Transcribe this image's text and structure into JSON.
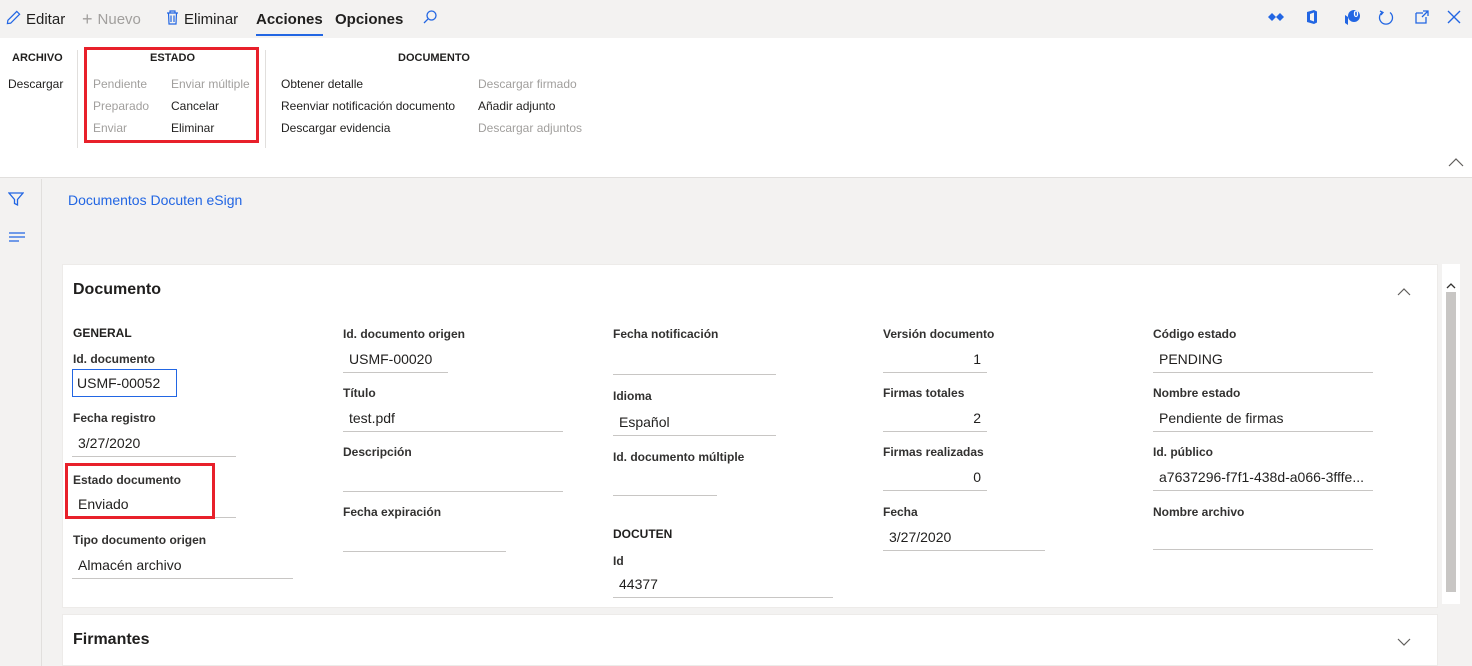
{
  "toolbar": {
    "edit_label": "Editar",
    "new_label": "Nuevo",
    "delete_label": "Eliminar",
    "tab_actions": "Acciones",
    "tab_options": "Opciones",
    "notification_count": "0"
  },
  "ribbon": {
    "archivo": {
      "header": "ARCHIVO",
      "items": [
        "Descargar"
      ]
    },
    "estado": {
      "header": "ESTADO",
      "col1": [
        "Pendiente",
        "Preparado",
        "Enviar"
      ],
      "col2": [
        "Enviar múltiple",
        "Cancelar",
        "Eliminar"
      ]
    },
    "documento": {
      "header": "DOCUMENTO",
      "col1": [
        "Obtener detalle",
        "Reenviar notificación documento",
        "Descargar evidencia"
      ],
      "col2": [
        "Descargar firmado",
        "Añadir adjunto",
        "Descargar adjuntos"
      ]
    }
  },
  "page": {
    "title": "Documentos Docuten eSign"
  },
  "documento": {
    "title": "Documento",
    "general_header": "GENERAL",
    "docuten_header": "DOCUTEN",
    "fields": {
      "id_documento": {
        "label": "Id. documento",
        "value": "USMF-00052"
      },
      "fecha_registro": {
        "label": "Fecha registro",
        "value": "3/27/2020"
      },
      "estado_documento": {
        "label": "Estado documento",
        "value": "Enviado"
      },
      "tipo_documento_origen": {
        "label": "Tipo documento origen",
        "value": "Almacén archivo"
      },
      "id_documento_origen": {
        "label": "Id. documento origen",
        "value": "USMF-00020"
      },
      "titulo": {
        "label": "Título",
        "value": "test.pdf"
      },
      "descripcion": {
        "label": "Descripción",
        "value": ""
      },
      "fecha_expiracion": {
        "label": "Fecha expiración",
        "value": ""
      },
      "fecha_notificacion": {
        "label": "Fecha notificación",
        "value": ""
      },
      "idioma": {
        "label": "Idioma",
        "value": "Español"
      },
      "id_documento_multiple": {
        "label": "Id. documento múltiple",
        "value": ""
      },
      "id": {
        "label": "Id",
        "value": "44377"
      },
      "version_documento": {
        "label": "Versión documento",
        "value": "1"
      },
      "firmas_totales": {
        "label": "Firmas totales",
        "value": "2"
      },
      "firmas_realizadas": {
        "label": "Firmas realizadas",
        "value": "0"
      },
      "fecha": {
        "label": "Fecha",
        "value": "3/27/2020"
      },
      "codigo_estado": {
        "label": "Código estado",
        "value": "PENDING"
      },
      "nombre_estado": {
        "label": "Nombre estado",
        "value": "Pendiente de firmas"
      },
      "id_publico": {
        "label": "Id. público",
        "value": "a7637296-f7f1-438d-a066-3fffe..."
      },
      "nombre_archivo": {
        "label": "Nombre archivo",
        "value": ""
      }
    }
  },
  "firmantes": {
    "title": "Firmantes"
  },
  "colors": {
    "accent": "#2266e3",
    "highlight": "#e8202a",
    "disabled": "#a19f9d"
  }
}
